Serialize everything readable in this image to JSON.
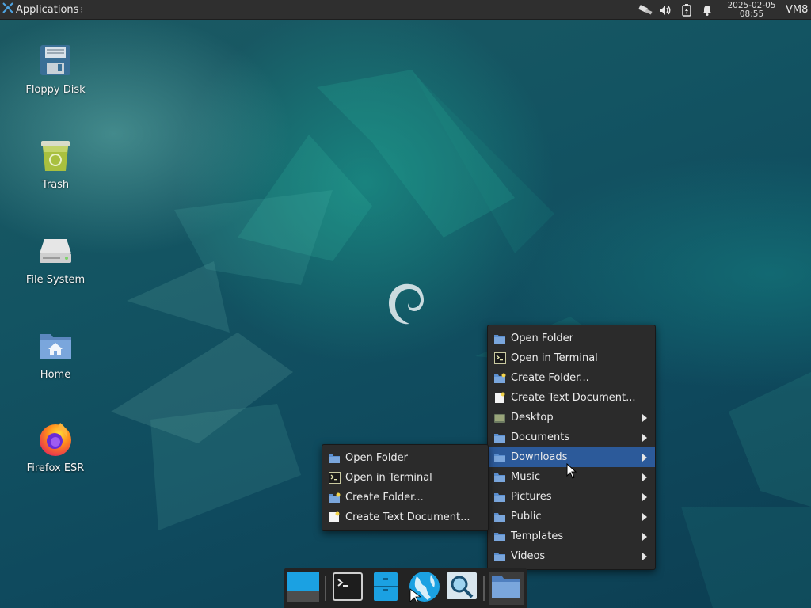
{
  "top_panel": {
    "applications_label": "Applications",
    "separator_glyph": "⁝",
    "tray_icons": [
      "network-icon",
      "volume-icon",
      "battery-icon",
      "notifications-icon"
    ],
    "clock_date": "2025-02-05",
    "clock_time": "08:55",
    "hostname": "VM8"
  },
  "desktop": {
    "icons": [
      {
        "label": "Floppy Disk",
        "icon": "floppy-disk-icon"
      },
      {
        "label": "Trash",
        "icon": "trash-icon"
      },
      {
        "label": "File System",
        "icon": "drive-icon"
      },
      {
        "label": "Home",
        "icon": "home-folder-icon"
      },
      {
        "label": "Firefox ESR",
        "icon": "firefox-icon"
      }
    ]
  },
  "main_menu": {
    "items": [
      {
        "label": "Open Folder",
        "icon": "folder-icon"
      },
      {
        "label": "Open in Terminal",
        "icon": "terminal-icon"
      },
      {
        "label": "Create Folder...",
        "icon": "new-folder-icon"
      },
      {
        "label": "Create Text Document...",
        "icon": "text-document-icon"
      },
      {
        "label": "Desktop",
        "icon": "desktop-folder-icon",
        "submenu": true
      },
      {
        "label": "Documents",
        "icon": "folder-icon",
        "submenu": true
      },
      {
        "label": "Downloads",
        "icon": "folder-icon",
        "submenu": true,
        "active": true
      },
      {
        "label": "Music",
        "icon": "folder-icon",
        "submenu": true
      },
      {
        "label": "Pictures",
        "icon": "folder-icon",
        "submenu": true
      },
      {
        "label": "Public",
        "icon": "folder-icon",
        "submenu": true
      },
      {
        "label": "Templates",
        "icon": "folder-icon",
        "submenu": true
      },
      {
        "label": "Videos",
        "icon": "folder-icon",
        "submenu": true
      }
    ]
  },
  "sub_menu": {
    "items": [
      {
        "label": "Open Folder",
        "icon": "folder-icon"
      },
      {
        "label": "Open in Terminal",
        "icon": "terminal-icon"
      },
      {
        "label": "Create Folder...",
        "icon": "new-folder-icon"
      },
      {
        "label": "Create Text Document...",
        "icon": "text-document-icon"
      }
    ]
  },
  "dock": {
    "items": [
      {
        "icon": "show-desktop-icon"
      },
      {
        "icon": "terminal-icon"
      },
      {
        "icon": "file-manager-icon"
      },
      {
        "icon": "web-browser-icon"
      },
      {
        "icon": "app-finder-icon"
      },
      {
        "icon": "folder-icon"
      }
    ]
  },
  "colors": {
    "panel": "#2f2f2f",
    "menu_bg": "#2b2b2b",
    "menu_highlight": "#2c5a9a",
    "folder_blue": "#5b8fd0"
  }
}
